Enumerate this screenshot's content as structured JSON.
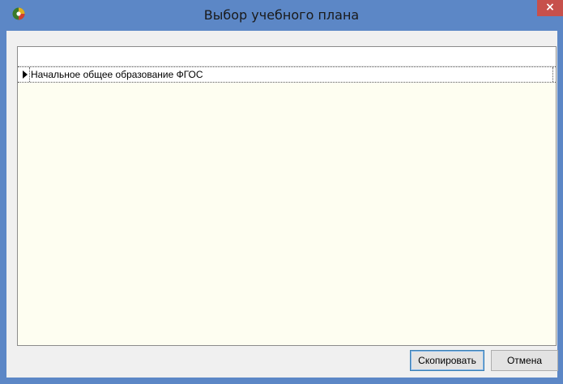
{
  "window": {
    "title": "Выбор учебного плана",
    "icon": "app-icon",
    "close_label": "×"
  },
  "grid": {
    "rows": [
      {
        "label": "Начальное общее образование ФГОС",
        "selected": true
      }
    ]
  },
  "buttons": {
    "copy_label": "Скопировать",
    "cancel_label": "Отмена"
  },
  "colors": {
    "titlebar": "#5c87c6",
    "close_button": "#c7504b",
    "grid_background": "#fefef1",
    "dialog_background": "#f0f0f0"
  }
}
